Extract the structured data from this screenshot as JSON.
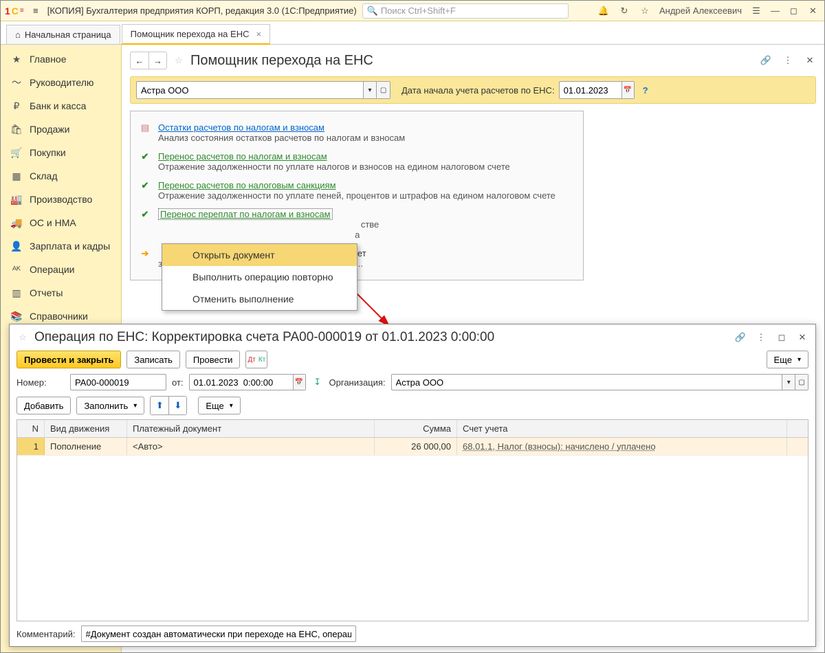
{
  "titlebar": {
    "logo": "1C",
    "title": "[КОПИЯ] Бухгалтерия предприятия КОРП, редакция 3.0  (1С:Предприятие)",
    "search_placeholder": "Поиск Ctrl+Shift+F",
    "user": "Андрей Алексеевич"
  },
  "tabs": {
    "home": "Начальная страница",
    "active": "Помощник перехода на ЕНС"
  },
  "sidebar": [
    {
      "icon": "★",
      "label": "Главное"
    },
    {
      "icon": "～",
      "label": "Руководителю"
    },
    {
      "icon": "₽",
      "label": "Банк и касса"
    },
    {
      "icon": "🛍",
      "label": "Продажи"
    },
    {
      "icon": "🛒",
      "label": "Покупки"
    },
    {
      "icon": "▦",
      "label": "Склад"
    },
    {
      "icon": "🏭",
      "label": "Производство"
    },
    {
      "icon": "🚚",
      "label": "ОС и НМА"
    },
    {
      "icon": "👤",
      "label": "Зарплата и кадры"
    },
    {
      "icon": "ᴬᴷ",
      "label": "Операции"
    },
    {
      "icon": "▥",
      "label": "Отчеты"
    },
    {
      "icon": "📚",
      "label": "Справочники"
    }
  ],
  "page": {
    "title": "Помощник перехода на ЕНС",
    "org": "Астра ООО",
    "date_label": "Дата начала учета расчетов по ЕНС:",
    "date_value": "01.01.2023"
  },
  "steps": [
    {
      "status": "doc",
      "title": "Остатки расчетов по налогам и взносам",
      "color": "blue",
      "desc": "Анализ состояния остатков расчетов по налогам и взносам"
    },
    {
      "status": "check",
      "title": "Перенос расчетов по налогам и взносам",
      "color": "green",
      "desc": "Отражение задолженности по уплате налогов и взносов на едином налоговом счете"
    },
    {
      "status": "check",
      "title": "Перенос расчетов по налоговым санкциям",
      "color": "green",
      "desc": "Отражение задолженности по уплате пеней, процентов и штрафов на едином налоговом счете"
    },
    {
      "status": "check",
      "title": "Перенос переплат по налогам и взносам",
      "color": "green",
      "dotted": true,
      "desc_partial1": "стве",
      "desc_partial2": "а"
    },
    {
      "status": "arrow",
      "title_partial": "ета в счет",
      "desc_partial": "задолженности по налогам, взносам, пеням и п..."
    }
  ],
  "context_menu": {
    "items": [
      "Открыть документ",
      "Выполнить операцию повторно",
      "Отменить выполнение"
    ],
    "selected_index": 0
  },
  "sub": {
    "title": "Операция по ЕНС: Корректировка счета РА00-000019 от 01.01.2023 0:00:00",
    "btn_primary": "Провести и закрыть",
    "btn_save": "Записать",
    "btn_post": "Провести",
    "btn_more": "Еще",
    "fields": {
      "num_label": "Номер:",
      "num_value": "РА00-000019",
      "from_label": "от:",
      "from_value": "01.01.2023  0:00:00",
      "org_label": "Организация:",
      "org_value": "Астра ООО"
    },
    "btn_add": "Добавить",
    "btn_fill": "Заполнить",
    "grid": {
      "headers": {
        "n": "N",
        "kind": "Вид движения",
        "doc": "Платежный документ",
        "sum": "Сумма",
        "acct": "Счет учета"
      },
      "rows": [
        {
          "n": "1",
          "kind": "Пополнение",
          "doc": "<Авто>",
          "sum": "26 000,00",
          "acct": "68.01.1, Налог (взносы): начислено / уплачено"
        }
      ]
    },
    "comment_label": "Комментарий:",
    "comment_value": "#Документ создан автоматически при переходе на ЕНС, операция"
  }
}
